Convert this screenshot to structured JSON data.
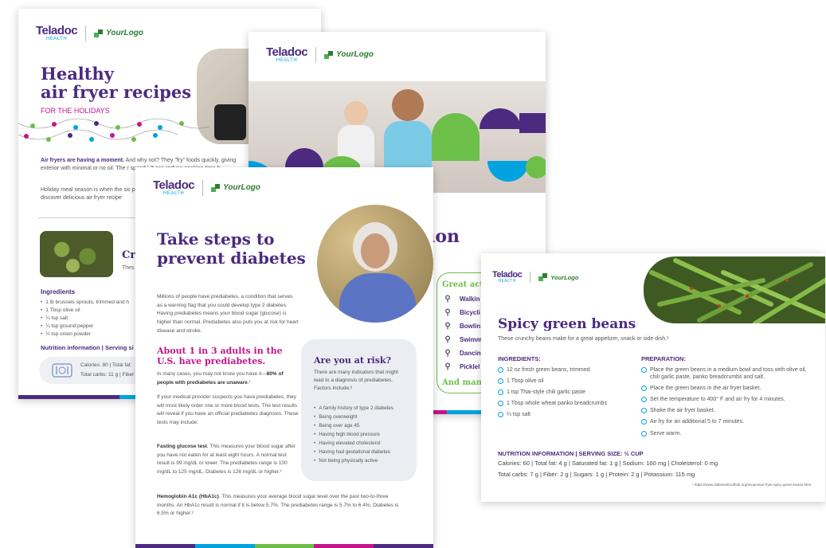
{
  "brand": {
    "teladoc": "Teladoc",
    "health": "HEALTH",
    "yourlogo": "YourLogo"
  },
  "colors": {
    "purple": "#4b2a7f",
    "magenta": "#c4148c",
    "blue": "#00a3e0",
    "green": "#6cc04a"
  },
  "page1": {
    "title_line1": "Healthy",
    "title_line2": "air fryer recipes",
    "subtitle": "FOR THE HOLIDAYS",
    "intro_bold": "Air fryers are having a moment.",
    "intro_text": " And why not? They \"fry\" foods quickly, giving exterior with minimal or no oil. The r speed.¹ It can reduce cooking time b",
    "para2": "Holiday meal season is when the sic probably not the place to cook a tur to discover delicious air fryer recipe",
    "recipe_title": "Cri",
    "recipe_desc": "Thes",
    "ingredients_heading": "Ingredients",
    "ingredients": [
      "1 lb brussels sprouts, trimmed and h",
      "1 Tbsp olive oil",
      "¼ tsp salt",
      "¼ tsp ground pepper",
      "½ tsp onion powder"
    ],
    "nutrition_heading": "Nutrition information  |  Serving si",
    "nutrition_line1": "Calories: 80  |  Total fat: ",
    "nutrition_line2": "Total carbs: 11 g  |  Fiber"
  },
  "page2": {
    "title_partial": "ion",
    "activities_heading": "Great activ",
    "activities": [
      {
        "icon": "walking-icon",
        "label": "Walkin"
      },
      {
        "icon": "bicycle-icon",
        "label": "Bicycli"
      },
      {
        "icon": "bowling-icon",
        "label": "Bowlin"
      },
      {
        "icon": "swimming-icon",
        "label": "Swimm"
      },
      {
        "icon": "dancing-icon",
        "label": "Dancin"
      },
      {
        "icon": "pickleball-icon",
        "label": "Picklel"
      }
    ],
    "and_many": "And many"
  },
  "page3": {
    "title_line1": "Take steps to",
    "title_line2": "prevent diabetes",
    "intro": "Millions of people have prediabetes, a condition that serves as a warning flag that you could develop type 2 diabetes. Having prediabetes means your blood sugar (glucose) is higher than normal. Prediabetes also puts you at risk for heart disease and stroke.",
    "stat_heading_line1": "About 1 in 3 adults in the",
    "stat_heading_line2": "U.S. have prediabetes.",
    "stat_text": "In many cases, you may not know you have it—",
    "stat_bold": "80% of people with prediabetes are unaware",
    "stat_sup": ".¹",
    "suspect_text": "If your medical provider suspects you have prediabetes, they will most likely order one or more blood tests. The test results will reveal if you have an official prediabetes diagnosis. These tests may include:",
    "fasting_bold": "Fasting glucose test",
    "fasting_text": ". This measures your blood sugar after you have not eaten for at least eight hours. A normal test result is 99 mg/dL or lower. The prediabetes range is 100 mg/dL to 125 mg/dL. Diabetes is 126 mg/dL or higher.²",
    "a1c_bold": "Hemoglobin A1c (HbA1c)",
    "a1c_text": ". This measures your average blood sugar level over the past two-to-three months. An HbA1c result is normal if it is below 5.7%. The prediabetes range is 5.7% to 6.4%. Diabetes is 6.5% or higher.²",
    "risk_heading": "Are you at risk?",
    "risk_intro": "There are many indicators that might lead to a diagnosis of prediabetes. Factors include:²",
    "risk_factors": [
      "A family history of type 2 diabetes",
      "Being overweight",
      "Being over age 45",
      "Having high blood pressure",
      "Having elevated cholesterol",
      "Having had gestational diabetes",
      "Not being physically active"
    ]
  },
  "page4": {
    "title": "Spicy green beans",
    "subtitle": "These crunchy beans make for a great appetizer, snack or side dish.¹",
    "ingredients_heading": "INGREDIENTS:",
    "ingredients": [
      "12 oz fresh green beans, trimmed",
      "1 Tbsp olive oil",
      "1 tsp Thai-style chili garlic paste",
      "1 Tbsp whole wheat panko breadcrumbs",
      "¼ tsp salt"
    ],
    "preparation_heading": "PREPARATION:",
    "preparation": [
      "Place the green beans in a medium bowl and toss with olive oil, chili garlic paste, panko breadcrumbs and salt.",
      "Place the green beans in the air fryer basket.",
      "Set the temperature to 400° F and air fry for 4 minutes.",
      "Shake the air fryer basket.",
      "Air fry for an additional 5 to 7 minutes.",
      "Serve warm."
    ],
    "nutrition_heading": "NUTRITION INFORMATION | SERVING SIZE: ½ CUP",
    "nutrition_line1": "Calories: 60  |  Total fat: 4 g  |  Saturated fat: 1 g  |  Sodium: 160 mg  |  Cholesterol: 0 mg",
    "nutrition_line2": "Total carbs: 7 g  |  Fiber: 2 g  |  Sugars: 1 g  |  Protein: 2 g  |  Potassium: 115 mg",
    "footnote": "¹ https://www.diabetesfoodhub.org/recipes/air-fryer-spicy-green-beans.html"
  }
}
